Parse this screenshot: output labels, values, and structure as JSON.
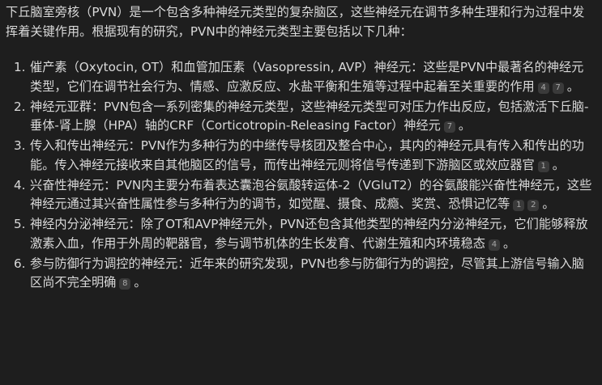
{
  "intro": "下丘脑室旁核（PVN）是一个包含多种神经元类型的复杂脑区，这些神经元在调节多种生理和行为过程中发挥着关键作用。根据现有的研究，PVN中的神经元类型主要包括以下几种：",
  "items": [
    {
      "num": "1.",
      "text": "催产素（Oxytocin, OT）和血管加压素（Vasopressin, AVP）神经元：这些是PVN中最著名的神经元类型，它们在调节社会行为、情感、应激反应、水盐平衡和生殖等过程中起着至关重要的作用",
      "cites": [
        "4",
        "7"
      ],
      "tail": "。"
    },
    {
      "num": "2.",
      "text": "神经元亚群：PVN包含一系列密集的神经元类型，这些神经元类型可对压力作出反应，包括激活下丘脑-垂体-肾上腺（HPA）轴的CRF（Corticotropin-Releasing Factor）神经元",
      "cites": [
        "7"
      ],
      "tail": "。"
    },
    {
      "num": "3.",
      "text": "传入和传出神经元：PVN作为多种行为的中继传导核团及整合中心，其内的神经元具有传入和传出的功能。传入神经元接收来自其他脑区的信号，而传出神经元则将信号传递到下游脑区或效应器官",
      "cites": [
        "1"
      ],
      "tail": "。"
    },
    {
      "num": "4.",
      "text": "兴奋性神经元：PVN内主要分布着表达囊泡谷氨酸转运体-2（VGluT2）的谷氨酸能兴奋性神经元，这些神经元通过其兴奋性属性参与多种行为的调节，如觉醒、摄食、成瘾、奖赏、恐惧记忆等",
      "cites": [
        "1",
        "2"
      ],
      "tail": "。"
    },
    {
      "num": "5.",
      "text": "神经内分泌神经元：除了OT和AVP神经元外，PVN还包含其他类型的神经内分泌神经元，它们能够释放激素入血，作用于外周的靶器官，参与调节机体的生长发育、代谢生殖和内环境稳态",
      "cites": [
        "4"
      ],
      "tail": "。"
    },
    {
      "num": "6.",
      "text": "参与防御行为调控的神经元：近年来的研究发现，PVN也参与防御行为的调控，尽管其上游信号输入脑区尚不完全明确",
      "cites": [
        "8"
      ],
      "tail": "。"
    }
  ]
}
